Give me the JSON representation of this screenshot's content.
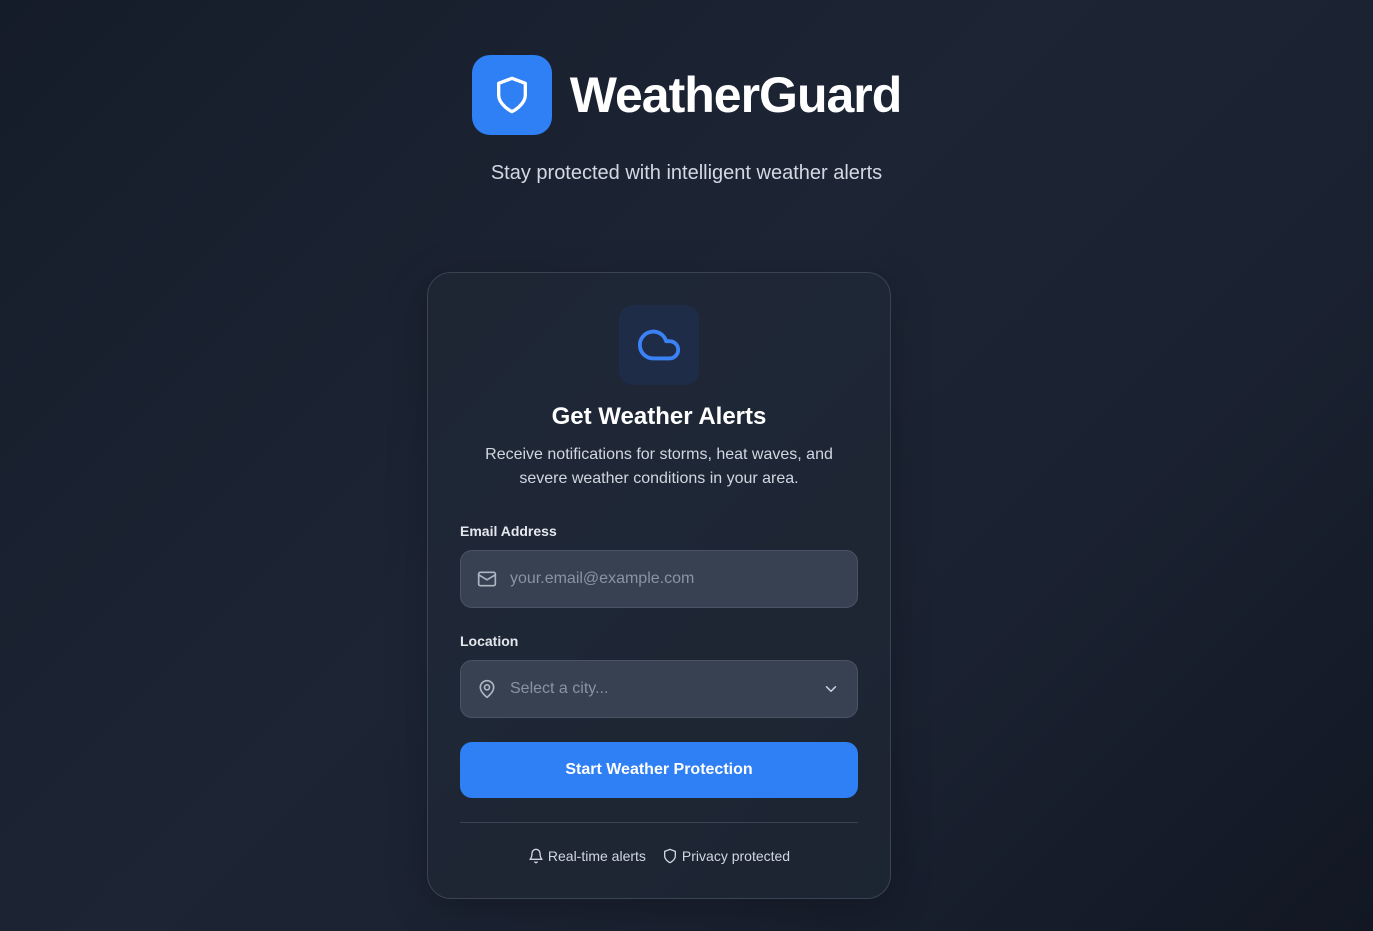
{
  "brand": {
    "name": "WeatherGuard",
    "tagline": "Stay protected with intelligent weather alerts",
    "logo_icon": "shield-icon",
    "accent_color": "#2f7ff5"
  },
  "card": {
    "icon": "cloud-icon",
    "title": "Get Weather Alerts",
    "description": "Receive notifications for storms, heat waves, and severe weather conditions in your area."
  },
  "form": {
    "email": {
      "label": "Email Address",
      "placeholder": "your.email@example.com",
      "value": "",
      "icon": "mail-icon"
    },
    "location": {
      "label": "Location",
      "placeholder": "Select a city...",
      "icon": "map-pin-icon"
    },
    "submit_label": "Start Weather Protection"
  },
  "features": [
    {
      "label": "Real-time alerts",
      "icon": "bell-icon"
    },
    {
      "label": "Privacy protected",
      "icon": "shield-icon"
    }
  ]
}
